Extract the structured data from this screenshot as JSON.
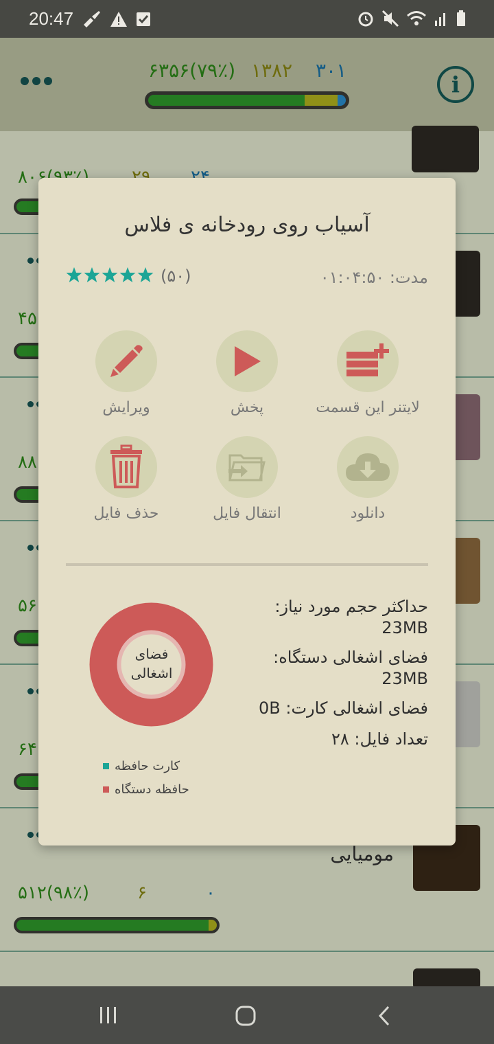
{
  "status_bar": {
    "time": "20:47",
    "left_icons": [
      "broom-icon",
      "warning-icon",
      "checkbox-icon"
    ],
    "right_icons": [
      "alarm-icon",
      "mute-icon",
      "wifi-icon",
      "signal-icon",
      "battery-icon"
    ]
  },
  "header": {
    "stat_total": "۶۳۵۶(۷۹٪)",
    "stat_partial": "۱۳۸۲",
    "stat_remaining": "۳۰۱",
    "progress": {
      "green": 0.79,
      "yellow": 0.17,
      "blue": 0.04
    }
  },
  "list": {
    "rows": [
      {
        "stat": "۸۰۶(۹۳٪)",
        "mid": "۲۹",
        "right": "۲۴"
      },
      {
        "stat": "۴۵"
      },
      {
        "stat": "۸۸"
      },
      {
        "stat": "۵۶"
      },
      {
        "stat": "۶۴"
      },
      {
        "title": "مومیایی",
        "stat": "۵۱۲(۹۸٪)",
        "mid": "۶",
        "right": "۰"
      }
    ]
  },
  "dialog": {
    "title": "آسیاب روی رودخانه ی فلاس",
    "rating_count": "(۵۰)",
    "stars": 5,
    "duration_label": "مدت:",
    "duration_value": "۰۱:۰۴:۵۰",
    "actions": {
      "leitner": "لایتنر این قسمت",
      "play": "پخش",
      "edit": "ویرایش",
      "download": "دانلود",
      "move_file": "انتقال فایل",
      "delete_file": "حذف فایل"
    },
    "storage": {
      "max_size_label": "حداکثر حجم مورد نیاز:",
      "max_size_value": "23MB",
      "device_used_label": "فضای اشغالی دستگاه:",
      "device_used_value": "23MB",
      "card_used_label": "فضای اشغالی کارت:",
      "card_used_value": "0B",
      "file_count_label": "تعداد فایل:",
      "file_count_value": "۲۸"
    },
    "donut": {
      "center_line1": "فضای",
      "center_line2": "اشغالی",
      "device_fraction": 1.0,
      "card_fraction": 0.0
    },
    "legend": {
      "card": "کارت حافظه",
      "device": "حافظه دستگاه"
    }
  },
  "colors": {
    "accent_teal": "#1ba596",
    "accent_red": "#cd5a58",
    "progress_green": "#2f9a2b",
    "progress_yellow": "#b5b41e",
    "progress_blue": "#2a8fd0"
  },
  "nav_bar": {
    "icons": [
      "recent-apps-icon",
      "home-icon",
      "back-icon"
    ]
  }
}
